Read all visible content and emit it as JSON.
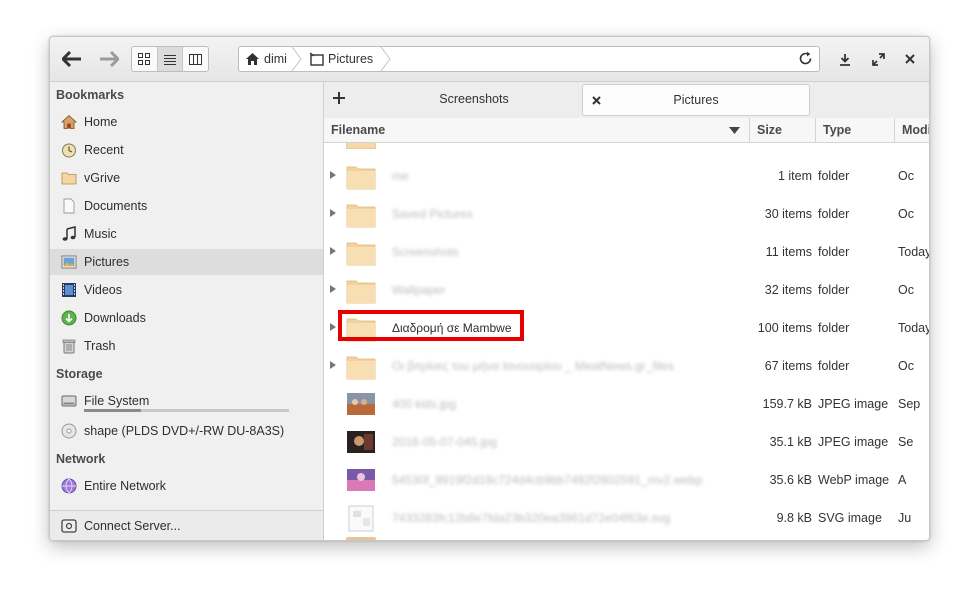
{
  "headerbar": {
    "icons": [
      "back-arrow-icon",
      "forward-arrow-icon",
      "grid-view-icon",
      "list-view-icon",
      "column-view-icon",
      "reload-icon",
      "download-icon",
      "maximize-icon",
      "close-icon"
    ],
    "breadcrumbs": [
      {
        "label": "dimi",
        "icon": "home-icon"
      },
      {
        "label": "Pictures",
        "icon": "pictures-folder-icon"
      }
    ]
  },
  "sidebar": {
    "sections": {
      "bookmarks": "Bookmarks",
      "storage": "Storage",
      "network": "Network"
    },
    "bookmarks": [
      {
        "label": "Home",
        "icon": "home-icon"
      },
      {
        "label": "Recent",
        "icon": "recent-clock-icon"
      },
      {
        "label": "vGrive",
        "icon": "folder-icon"
      },
      {
        "label": "Documents",
        "icon": "document-icon"
      },
      {
        "label": "Music",
        "icon": "music-note-icon"
      },
      {
        "label": "Pictures",
        "icon": "pictures-icon"
      },
      {
        "label": "Videos",
        "icon": "film-icon"
      },
      {
        "label": "Downloads",
        "icon": "download-circle-icon"
      },
      {
        "label": "Trash",
        "icon": "trash-icon"
      }
    ],
    "storage": [
      {
        "label": "File System",
        "icon": "harddisk-icon",
        "usage_fraction": 0.28
      },
      {
        "label": "shape (PLDS DVD+/-RW DU-8A3S)",
        "icon": "optical-disc-icon"
      }
    ],
    "network": [
      {
        "label": "Entire Network",
        "icon": "network-globe-icon"
      }
    ],
    "connect_server": {
      "label": "Connect Server...",
      "icon": "server-icon"
    }
  },
  "tabs": {
    "add_icon": "plus-icon",
    "items": [
      {
        "label": "Screenshots",
        "active": false
      },
      {
        "label": "Pictures",
        "active": true,
        "close_icon": "close-icon"
      }
    ]
  },
  "columns": {
    "filename": "Filename",
    "size": "Size",
    "type": "Type",
    "modified": "Modi"
  },
  "files": [
    {
      "name": "me",
      "size": "1 item",
      "type": "folder",
      "modified": "Oc",
      "kind": "folder"
    },
    {
      "name": "Saved Pictures",
      "size": "30 items",
      "type": "folder",
      "modified": "Oc",
      "kind": "folder"
    },
    {
      "name": "Screenshots",
      "size": "11 items",
      "type": "folder",
      "modified": "Today",
      "kind": "folder"
    },
    {
      "name": "Wallpaper",
      "size": "32 items",
      "type": "folder",
      "modified": "Oc",
      "kind": "folder"
    },
    {
      "name": "Διαδρομή σε Mambwe",
      "size": "100 items",
      "type": "folder",
      "modified": "Today",
      "kind": "folder",
      "highlighted": true
    },
    {
      "name": "Οι βιτρίνες του μήνα Ιανουαρίου _ MeatNews.gr_files",
      "size": "67 items",
      "type": "folder",
      "modified": "Oc",
      "kind": "folder"
    },
    {
      "name": "400 kids.jpg",
      "size": "159.7 kB",
      "type": "JPEG image",
      "modified": "Sep",
      "kind": "photo1"
    },
    {
      "name": "2016-05-07-045.jpg",
      "size": "35.1 kB",
      "type": "JPEG image",
      "modified": "Se",
      "kind": "photo2"
    },
    {
      "name": "54530f_9919f2d18c724d4cb9bb7492f2602591_mv2.webp",
      "size": "35.6 kB",
      "type": "WebP image",
      "modified": "A",
      "kind": "photo3"
    },
    {
      "name": "7433283fc12b8e7fda23b320ea3961d72e04f63e.svg",
      "size": "9.8 kB",
      "type": "SVG image",
      "modified": "Ju",
      "kind": "svg"
    }
  ],
  "colors": {
    "highlight_box": "#e60000",
    "folder": "#f5d9a8",
    "accent_usage": "#8a8a8a"
  }
}
